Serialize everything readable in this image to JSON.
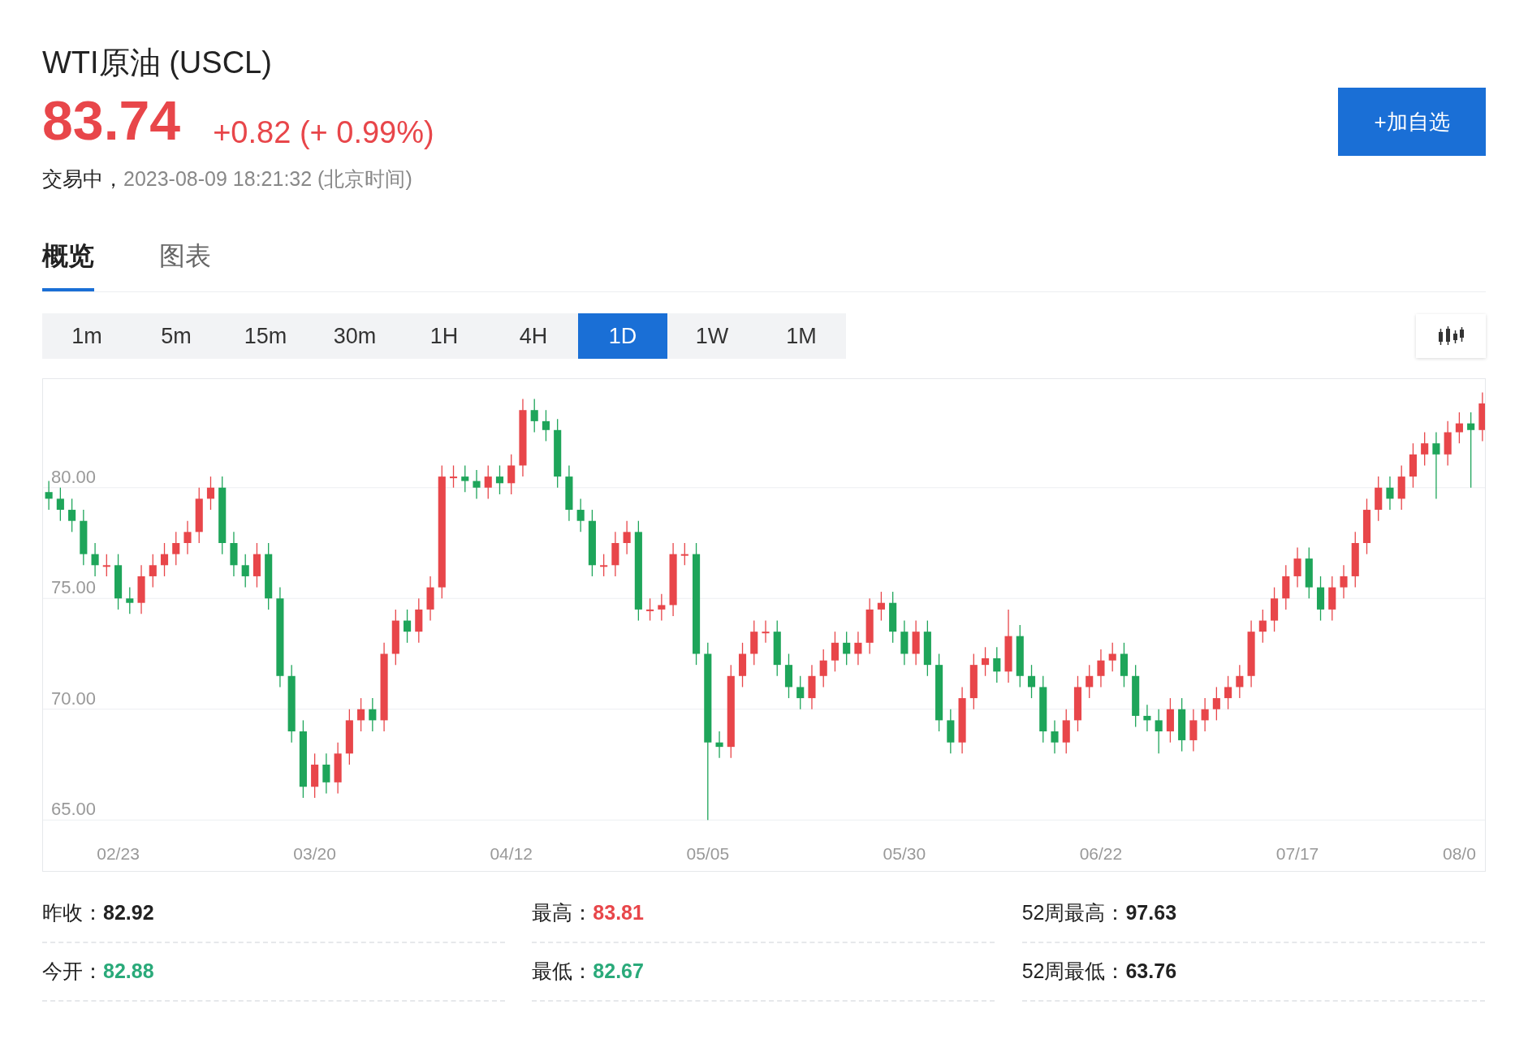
{
  "header": {
    "title": "WTI原油 (USCL)",
    "price": "83.74",
    "change": "+0.82 (+ 0.99%)",
    "status": "交易中，",
    "time": "2023-08-09 18:21:32 (北京时间)",
    "watch_button": "+加自选"
  },
  "tabs": [
    {
      "label": "概览",
      "selected": true
    },
    {
      "label": "图表",
      "selected": false
    }
  ],
  "intervals": [
    {
      "label": "1m",
      "selected": false
    },
    {
      "label": "5m",
      "selected": false
    },
    {
      "label": "15m",
      "selected": false
    },
    {
      "label": "30m",
      "selected": false
    },
    {
      "label": "1H",
      "selected": false
    },
    {
      "label": "4H",
      "selected": false
    },
    {
      "label": "1D",
      "selected": true
    },
    {
      "label": "1W",
      "selected": false
    },
    {
      "label": "1M",
      "selected": false
    }
  ],
  "chart": {
    "chart_data": {
      "type": "candlestick",
      "ylim": [
        62.7,
        84.9
      ],
      "yticks": [
        {
          "value": 80,
          "label": "80.00"
        },
        {
          "value": 75,
          "label": "75.00"
        },
        {
          "value": 70,
          "label": "70.00"
        },
        {
          "value": 65,
          "label": "65.00"
        }
      ],
      "categories": [
        null,
        null,
        null,
        null,
        null,
        null,
        "02/23",
        null,
        null,
        null,
        null,
        null,
        null,
        null,
        null,
        null,
        null,
        null,
        null,
        null,
        null,
        null,
        null,
        "03/20",
        null,
        null,
        null,
        null,
        null,
        null,
        null,
        null,
        null,
        null,
        null,
        null,
        null,
        null,
        null,
        null,
        "04/12",
        null,
        null,
        null,
        null,
        null,
        null,
        null,
        null,
        null,
        null,
        null,
        null,
        null,
        null,
        null,
        null,
        "05/05",
        null,
        null,
        null,
        null,
        null,
        null,
        null,
        null,
        null,
        null,
        null,
        null,
        null,
        null,
        null,
        null,
        "05/30",
        null,
        null,
        null,
        null,
        null,
        null,
        null,
        null,
        null,
        null,
        null,
        null,
        null,
        null,
        null,
        null,
        "06/22",
        null,
        null,
        null,
        null,
        null,
        null,
        null,
        null,
        null,
        null,
        null,
        null,
        null,
        null,
        null,
        null,
        "07/17",
        null,
        null,
        null,
        null,
        null,
        null,
        null,
        null,
        null,
        null,
        null,
        null,
        null,
        "08/0",
        null,
        null
      ],
      "grid": true,
      "ohlc": [
        [
          79.8,
          80.3,
          79,
          79.5
        ],
        [
          79.5,
          80,
          78.5,
          79
        ],
        [
          79,
          79.5,
          78,
          78.5
        ],
        [
          78.5,
          79,
          76.5,
          77
        ],
        [
          77,
          77.5,
          76,
          76.5
        ],
        [
          76.5,
          77,
          76,
          76.5
        ],
        [
          76.5,
          77,
          74.5,
          75
        ],
        [
          75,
          75.5,
          74.3,
          74.8
        ],
        [
          74.8,
          76.5,
          74.3,
          76
        ],
        [
          76,
          77,
          75.5,
          76.5
        ],
        [
          76.5,
          77.5,
          76,
          77
        ],
        [
          77,
          78,
          76.5,
          77.5
        ],
        [
          77.5,
          78.5,
          77,
          78
        ],
        [
          78,
          80,
          77.5,
          79.5
        ],
        [
          79.5,
          80.5,
          79,
          80
        ],
        [
          80,
          80.5,
          77,
          77.5
        ],
        [
          77.5,
          78,
          76,
          76.5
        ],
        [
          76.5,
          77,
          75.5,
          76
        ],
        [
          76,
          77.5,
          75.5,
          77
        ],
        [
          77,
          77.5,
          74.5,
          75
        ],
        [
          75,
          75.5,
          71,
          71.5
        ],
        [
          71.5,
          72,
          68.5,
          69
        ],
        [
          69,
          69.5,
          66,
          66.5
        ],
        [
          66.5,
          68,
          66,
          67.5
        ],
        [
          67.5,
          68,
          66.2,
          66.7
        ],
        [
          66.7,
          68.5,
          66.2,
          68
        ],
        [
          68,
          70,
          67.5,
          69.5
        ],
        [
          69.5,
          70.5,
          69,
          70
        ],
        [
          70,
          70.5,
          69,
          69.5
        ],
        [
          69.5,
          73,
          69,
          72.5
        ],
        [
          72.5,
          74.5,
          72,
          74
        ],
        [
          74,
          74.5,
          73,
          73.5
        ],
        [
          73.5,
          75,
          73,
          74.5
        ],
        [
          74.5,
          76,
          74,
          75.5
        ],
        [
          75.5,
          81,
          75,
          80.5
        ],
        [
          80.5,
          81,
          80,
          80.5
        ],
        [
          80.5,
          81,
          79.8,
          80.3
        ],
        [
          80.3,
          80.8,
          79.5,
          80
        ],
        [
          80,
          81,
          79.5,
          80.5
        ],
        [
          80.5,
          81,
          79.7,
          80.2
        ],
        [
          80.2,
          81.5,
          79.7,
          81
        ],
        [
          81,
          84,
          80.5,
          83.5
        ],
        [
          83.5,
          84,
          82.5,
          83
        ],
        [
          83,
          83.5,
          82.1,
          82.6
        ],
        [
          82.6,
          83.1,
          80,
          80.5
        ],
        [
          80.5,
          81,
          78.5,
          79
        ],
        [
          79,
          79.5,
          78,
          78.5
        ],
        [
          78.5,
          79,
          76,
          76.5
        ],
        [
          76.5,
          77,
          76,
          76.5
        ],
        [
          76.5,
          78,
          76,
          77.5
        ],
        [
          77.5,
          78.5,
          77,
          78
        ],
        [
          78,
          78.5,
          74,
          74.5
        ],
        [
          74.5,
          75,
          74,
          74.5
        ],
        [
          74.5,
          75.2,
          74,
          74.7
        ],
        [
          74.7,
          77.5,
          74.2,
          77
        ],
        [
          77,
          77.5,
          76.5,
          77
        ],
        [
          77,
          77.5,
          72,
          72.5
        ],
        [
          72.5,
          73,
          65,
          68.5
        ],
        [
          68.5,
          69,
          67.8,
          68.3
        ],
        [
          68.3,
          72,
          67.8,
          71.5
        ],
        [
          71.5,
          73,
          71,
          72.5
        ],
        [
          72.5,
          74,
          72,
          73.5
        ],
        [
          73.5,
          74,
          73,
          73.5
        ],
        [
          73.5,
          74,
          71.5,
          72
        ],
        [
          72,
          72.5,
          70.5,
          71
        ],
        [
          71,
          71.5,
          70,
          70.5
        ],
        [
          70.5,
          72,
          70,
          71.5
        ],
        [
          71.5,
          72.7,
          71,
          72.2
        ],
        [
          72.2,
          73.5,
          71.7,
          73
        ],
        [
          73,
          73.5,
          72,
          72.5
        ],
        [
          72.5,
          73.5,
          72,
          73
        ],
        [
          73,
          75,
          72.5,
          74.5
        ],
        [
          74.5,
          75.3,
          74,
          74.8
        ],
        [
          74.8,
          75.3,
          73,
          73.5
        ],
        [
          73.5,
          74,
          72,
          72.5
        ],
        [
          72.5,
          74,
          72,
          73.5
        ],
        [
          73.5,
          74,
          71.5,
          72
        ],
        [
          72,
          72.5,
          69,
          69.5
        ],
        [
          69.5,
          70,
          68,
          68.5
        ],
        [
          68.5,
          71,
          68,
          70.5
        ],
        [
          70.5,
          72.5,
          70,
          72
        ],
        [
          72,
          72.8,
          71.5,
          72.3
        ],
        [
          72.3,
          72.8,
          71.2,
          71.7
        ],
        [
          71.7,
          74.5,
          71.2,
          73.3
        ],
        [
          73.3,
          73.8,
          71,
          71.5
        ],
        [
          71.5,
          72,
          70.5,
          71
        ],
        [
          71,
          71.5,
          68.5,
          69
        ],
        [
          69,
          69.5,
          68,
          68.5
        ],
        [
          68.5,
          70,
          68,
          69.5
        ],
        [
          69.5,
          71.5,
          69,
          71
        ],
        [
          71,
          72,
          70.5,
          71.5
        ],
        [
          71.5,
          72.7,
          71,
          72.2
        ],
        [
          72.2,
          73,
          71.7,
          72.5
        ],
        [
          72.5,
          73,
          71,
          71.5
        ],
        [
          71.5,
          72,
          69.2,
          69.7
        ],
        [
          69.7,
          70.2,
          69,
          69.5
        ],
        [
          69.5,
          70,
          68,
          69
        ],
        [
          69,
          70.5,
          68.5,
          70
        ],
        [
          70,
          70.5,
          68.1,
          68.6
        ],
        [
          68.6,
          70,
          68.1,
          69.5
        ],
        [
          69.5,
          70.5,
          69,
          70
        ],
        [
          70,
          71,
          69.5,
          70.5
        ],
        [
          70.5,
          71.5,
          70,
          71
        ],
        [
          71,
          72,
          70.5,
          71.5
        ],
        [
          71.5,
          74,
          71,
          73.5
        ],
        [
          73.5,
          74.5,
          73,
          74
        ],
        [
          74,
          75.5,
          73.5,
          75
        ],
        [
          75,
          76.5,
          74.5,
          76
        ],
        [
          76,
          77.3,
          75.5,
          76.8
        ],
        [
          76.8,
          77.3,
          75,
          75.5
        ],
        [
          75.5,
          76,
          74,
          74.5
        ],
        [
          74.5,
          76,
          74,
          75.5
        ],
        [
          75.5,
          76.5,
          75,
          76
        ],
        [
          76,
          78,
          75.5,
          77.5
        ],
        [
          77.5,
          79.5,
          77,
          79
        ],
        [
          79,
          80.5,
          78.5,
          80
        ],
        [
          80,
          80.5,
          79,
          79.5
        ],
        [
          79.5,
          81,
          79,
          80.5
        ],
        [
          80.5,
          82,
          80,
          81.5
        ],
        [
          81.5,
          82.5,
          81,
          82
        ],
        [
          82,
          82.5,
          79.5,
          81.5
        ],
        [
          81.5,
          83,
          81,
          82.5
        ],
        [
          82.5,
          83.4,
          82,
          82.9
        ],
        [
          82.9,
          83.4,
          80,
          82.6
        ],
        [
          82.6,
          84.3,
          82.1,
          83.8
        ]
      ]
    }
  },
  "stats": [
    {
      "label": "昨收：",
      "value": "82.92",
      "color": "#222222"
    },
    {
      "label": "最高：",
      "value": "83.81",
      "color": "#e8464a"
    },
    {
      "label": "52周最高：",
      "value": "97.63",
      "color": "#222222"
    },
    {
      "label": "今开：",
      "value": "82.88",
      "color": "#2aaa7a"
    },
    {
      "label": "最低：",
      "value": "82.67",
      "color": "#2aaa7a"
    },
    {
      "label": "52周最低：",
      "value": "63.76",
      "color": "#222222"
    }
  ]
}
